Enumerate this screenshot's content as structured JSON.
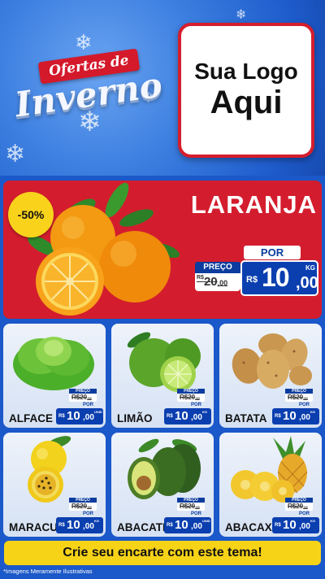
{
  "header": {
    "promo_line1": "Ofertas de",
    "promo_line2": "Inverno",
    "logo_line1": "Sua Logo",
    "logo_line2": "Aqui"
  },
  "featured": {
    "name": "LARANJA",
    "discount_badge": "-50%",
    "price_label": "PREÇO",
    "old_price_currency": "R$",
    "old_price_int": "20",
    "old_price_cents": ",00",
    "por_label": "POR",
    "new_price_currency": "R$",
    "new_price_int": "10",
    "new_price_cents": ",00",
    "unit": "KG"
  },
  "products": [
    {
      "name": "ALFACE",
      "price_label": "PREÇO",
      "old_price": "R$20",
      "old_cents": ",00",
      "por_label": "POR",
      "currency": "R$",
      "price_int": "10",
      "price_cents": ",00",
      "unit": "UNID"
    },
    {
      "name": "LIMÃO",
      "price_label": "PREÇO",
      "old_price": "R$20",
      "old_cents": ",00",
      "por_label": "POR",
      "currency": "R$",
      "price_int": "10",
      "price_cents": ",00",
      "unit": "KG"
    },
    {
      "name": "BATATA",
      "price_label": "PREÇO",
      "old_price": "R$20",
      "old_cents": ",00",
      "por_label": "POR",
      "currency": "R$",
      "price_int": "10",
      "price_cents": ",00",
      "unit": "KG"
    },
    {
      "name": "MARACUJÁ",
      "price_label": "PREÇO",
      "old_price": "R$20",
      "old_cents": ",00",
      "por_label": "POR",
      "currency": "R$",
      "price_int": "10",
      "price_cents": ",00",
      "unit": "KG"
    },
    {
      "name": "ABACATE",
      "price_label": "PREÇO",
      "old_price": "R$20",
      "old_cents": ",00",
      "por_label": "POR",
      "currency": "R$",
      "price_int": "10",
      "price_cents": ",00",
      "unit": "UNID"
    },
    {
      "name": "ABACAXI",
      "price_label": "PREÇO",
      "old_price": "R$20",
      "old_cents": ",00",
      "por_label": "POR",
      "currency": "R$",
      "price_int": "10",
      "price_cents": ",00",
      "unit": "KG"
    }
  ],
  "footer": {
    "cta": "Crie seu encarte com este tema!",
    "disclaimer": "*Imagens Meramente Ilustrativas"
  },
  "colors": {
    "background_blue": "#1b58c9",
    "accent_red": "#d31d2e",
    "price_blue": "#0b3fb0",
    "cta_yellow": "#f7d318"
  },
  "icons": [
    "snowflake-icon"
  ]
}
